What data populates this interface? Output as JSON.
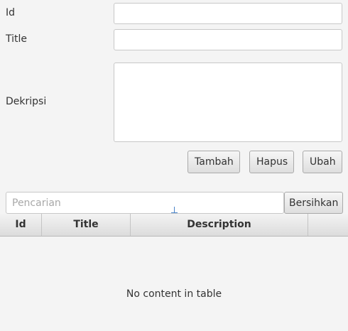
{
  "form": {
    "id_label": "Id",
    "title_label": "Title",
    "description_label": "Dekripsi"
  },
  "actions": {
    "add_label": "Tambah",
    "delete_label": "Hapus",
    "edit_label": "Ubah"
  },
  "search": {
    "placeholder": "Pencarian",
    "clear_label": "Bersihkan"
  },
  "table": {
    "columns": [
      "Id",
      "Title",
      "Description",
      ""
    ],
    "rows": [],
    "empty_message": "No content in table"
  }
}
